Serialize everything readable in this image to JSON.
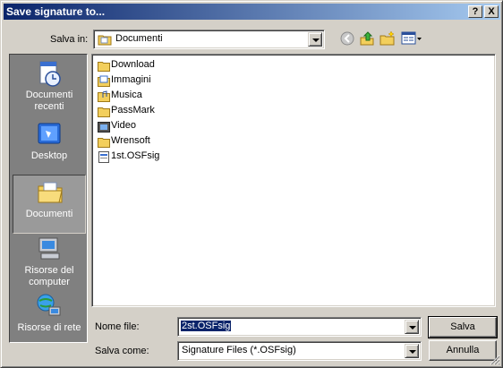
{
  "window": {
    "title": "Save signature to..."
  },
  "titlebar": {
    "help_label": "?",
    "close_label": "X"
  },
  "location": {
    "label": "Salva in:",
    "value": "Documenti"
  },
  "places": [
    {
      "label": "Documenti recenti",
      "icon": "recent-documents-icon"
    },
    {
      "label": "Desktop",
      "icon": "desktop-icon"
    },
    {
      "label": "Documenti",
      "icon": "documents-folder-icon"
    },
    {
      "label": "Risorse del computer",
      "icon": "my-computer-icon"
    },
    {
      "label": "Risorse di rete",
      "icon": "network-icon"
    }
  ],
  "files": [
    {
      "name": "Download",
      "icon": "folder-icon"
    },
    {
      "name": "Immagini",
      "icon": "pictures-folder-icon"
    },
    {
      "name": "Musica",
      "icon": "music-folder-icon"
    },
    {
      "name": "PassMark",
      "icon": "folder-icon"
    },
    {
      "name": "Video",
      "icon": "video-folder-icon"
    },
    {
      "name": "Wrensoft",
      "icon": "folder-icon"
    },
    {
      "name": "1st.OSFsig",
      "icon": "file-icon"
    }
  ],
  "filename": {
    "label": "Nome file:",
    "value": "2st.OSFsig"
  },
  "filetype": {
    "label": "Salva come:",
    "value": "Signature Files (*.OSFsig)"
  },
  "buttons": {
    "save": "Salva",
    "cancel": "Annulla"
  },
  "colors": {
    "title_start": "#0a246a",
    "title_end": "#a6caf0",
    "selection": "#0a246a",
    "face": "#d4d0c8"
  }
}
